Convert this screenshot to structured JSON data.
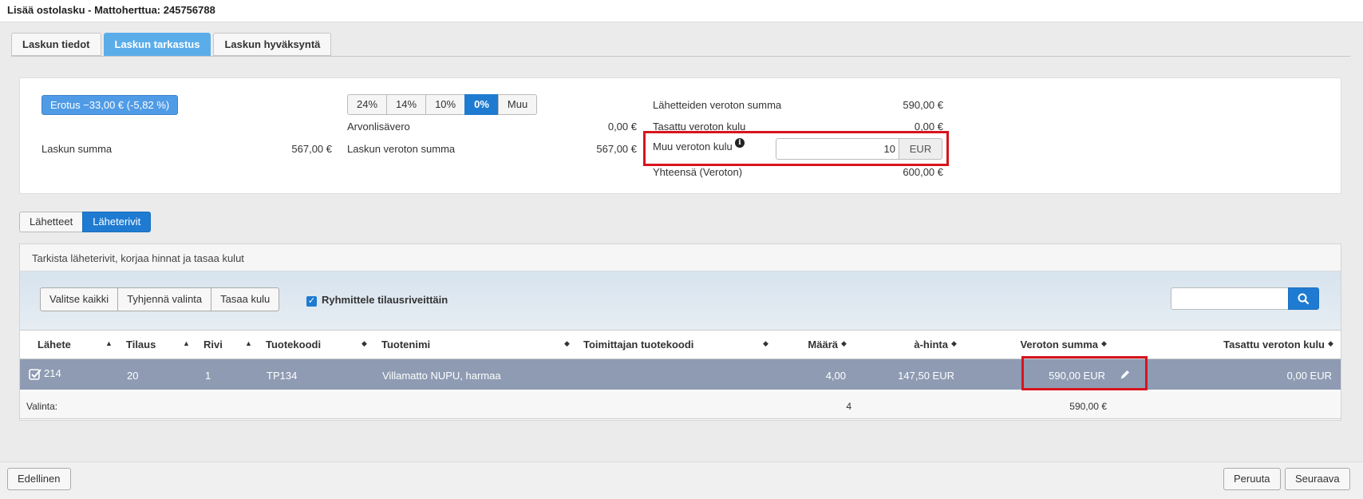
{
  "window": {
    "title": "Lisää ostolasku - Mattoherttua: 245756788"
  },
  "tabs": [
    {
      "label": "Laskun tiedot",
      "active": false
    },
    {
      "label": "Laskun tarkastus",
      "active": true
    },
    {
      "label": "Laskun hyväksyntä",
      "active": false
    }
  ],
  "summary": {
    "difference_badge": "Erotus −33,00 € (-5,82 %)",
    "invoice_sum_label": "Laskun summa",
    "invoice_sum_value": "567,00 €",
    "vat_options": [
      "24%",
      "14%",
      "10%",
      "0%",
      "Muu"
    ],
    "vat_selected": "0%",
    "vat_label": "Arvonlisävero",
    "vat_value": "0,00 €",
    "net_sum_label": "Laskun veroton summa",
    "net_sum_value": "567,00 €",
    "delivery_net_label": "Lähetteiden veroton summa",
    "delivery_net_value": "590,00 €",
    "leveled_cost_label": "Tasattu veroton kulu",
    "leveled_cost_value": "0,00 €",
    "other_cost_label": "Muu veroton kulu",
    "other_cost_input": "10",
    "other_cost_currency": "EUR",
    "total_label": "Yhteensä (Veroton)",
    "total_value": "600,00 €"
  },
  "subtabs": [
    {
      "label": "Lähetteet",
      "active": false
    },
    {
      "label": "Läheterivit",
      "active": true
    }
  ],
  "grid": {
    "heading": "Tarkista läheterivit, korjaa hinnat ja tasaa kulut",
    "buttons": [
      "Valitse kaikki",
      "Tyhjennä valinta",
      "Tasaa kulu"
    ],
    "group_checkbox_label": "Ryhmittele tilausriveittäin",
    "group_checked": true,
    "search_value": "",
    "columns": [
      "Lähete",
      "Tilaus",
      "Rivi",
      "Tuotekoodi",
      "Tuotenimi",
      "Toimittajan tuotekoodi",
      "Määrä",
      "à-hinta",
      "Veroton summa",
      "Tasattu veroton kulu"
    ],
    "rows": [
      {
        "lahete": "214",
        "tilaus": "20",
        "rivi": "1",
        "tuotekoodi": "TP134",
        "tuotenimi": "Villamatto NUPU, harmaa",
        "toimittajan_tuotekoodi": "",
        "maara": "4,00",
        "a_hinta": "147,50 EUR",
        "veroton_summa": "590,00 EUR",
        "tasattu_kulu": "0,00 EUR",
        "selected": true
      }
    ],
    "footer": {
      "label": "Valinta:",
      "maara": "4",
      "veroton_summa": "590,00 €"
    }
  },
  "footer_buttons": {
    "previous": "Edellinen",
    "cancel": "Peruuta",
    "next": "Seuraava"
  },
  "colors": {
    "accent": "#1f7bd1",
    "active_tab": "#5badea",
    "selected_row": "#8e9bb3",
    "highlight": "#d7141d"
  }
}
